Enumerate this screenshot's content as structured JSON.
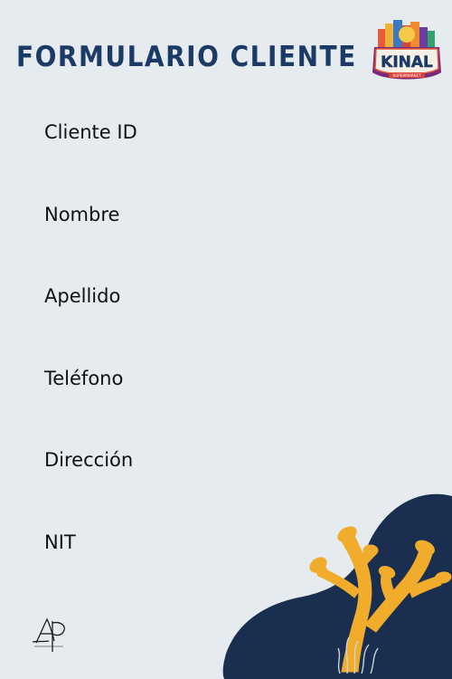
{
  "form": {
    "title": "FORMULARIO CLIENTE",
    "fields": [
      {
        "label": "Cliente  ID"
      },
      {
        "label": "Nombre"
      },
      {
        "label": "Apellido"
      },
      {
        "label": "Teléfono"
      },
      {
        "label": "Dirección"
      },
      {
        "label": "NIT"
      }
    ]
  },
  "logo": {
    "brand": "KINAL",
    "subtitle": "SUPERMARKET",
    "icon": "kinal-logo"
  },
  "decoration": {
    "blob_icon": "navy-blob",
    "coral_icon": "coral-illustration",
    "monogram_icon": "ap-monogram"
  },
  "colors": {
    "background": "#e5ebee",
    "title": "#1c3a66",
    "label": "#111111",
    "blob": "#1a2e4f",
    "coral": "#f0ac2a"
  }
}
